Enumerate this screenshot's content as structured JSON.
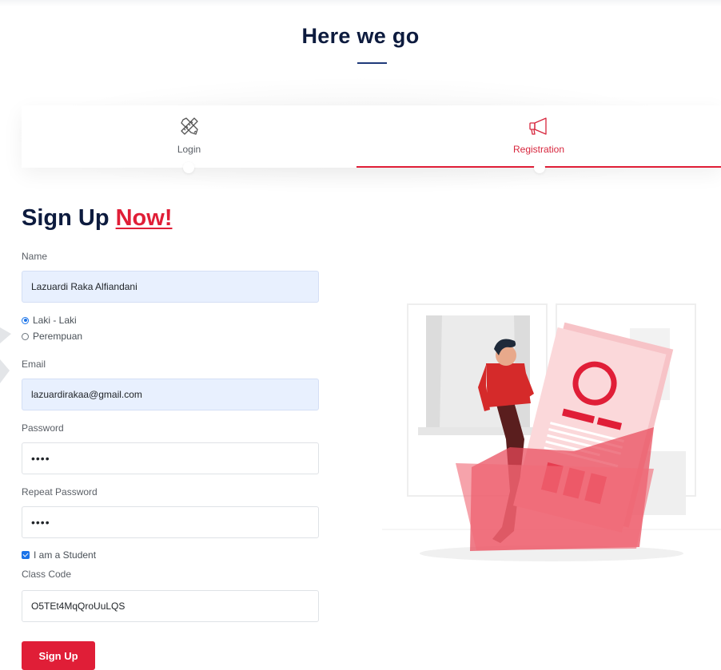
{
  "header": {
    "title": "Here we go"
  },
  "tabs": [
    {
      "label": "Login",
      "icon": "pencil-ruler-icon",
      "active": false
    },
    {
      "label": "Registration",
      "icon": "megaphone-icon",
      "active": true
    }
  ],
  "form": {
    "title_main": "Sign Up",
    "title_accent": "Now!",
    "name": {
      "label": "Name",
      "value": "Lazuardi Raka Alfiandani"
    },
    "gender": {
      "options": [
        "Laki - Laki",
        "Perempuan"
      ],
      "selected": "Laki - Laki"
    },
    "email": {
      "label": "Email",
      "value": "lazuardirakaa@gmail.com"
    },
    "password": {
      "label": "Password",
      "value": "••••"
    },
    "repeat_password": {
      "label": "Repeat Password",
      "value": "••••"
    },
    "student": {
      "label": "I am a Student",
      "checked": true
    },
    "class_code": {
      "label": "Class Code",
      "value": "O5TEt4MqQroUuLQS"
    },
    "submit_label": "Sign Up"
  },
  "colors": {
    "accent": "#e01e37",
    "navy": "#0d1b3e",
    "autofill": "#e8f0fe"
  }
}
